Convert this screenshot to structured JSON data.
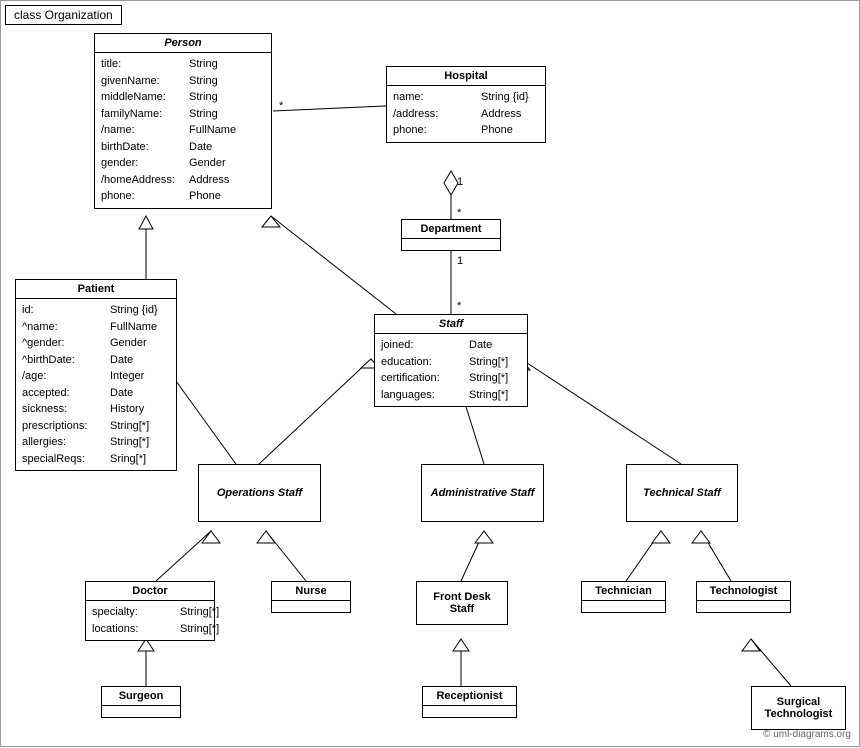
{
  "title": "class Organization",
  "copyright": "© uml-diagrams.org",
  "classes": {
    "person": {
      "name": "Person",
      "italic": true,
      "attrs": [
        {
          "name": "title:",
          "type": "String"
        },
        {
          "name": "givenName:",
          "type": "String"
        },
        {
          "name": "middleName:",
          "type": "String"
        },
        {
          "name": "familyName:",
          "type": "String"
        },
        {
          "name": "/name:",
          "type": "FullName"
        },
        {
          "name": "birthDate:",
          "type": "Date"
        },
        {
          "name": "gender:",
          "type": "Gender"
        },
        {
          "name": "/homeAddress:",
          "type": "Address"
        },
        {
          "name": "phone:",
          "type": "Phone"
        }
      ]
    },
    "hospital": {
      "name": "Hospital",
      "italic": false,
      "attrs": [
        {
          "name": "name:",
          "type": "String {id}"
        },
        {
          "name": "/address:",
          "type": "Address"
        },
        {
          "name": "phone:",
          "type": "Phone"
        }
      ]
    },
    "patient": {
      "name": "Patient",
      "italic": false,
      "attrs": [
        {
          "name": "id:",
          "type": "String {id}"
        },
        {
          "name": "^name:",
          "type": "FullName"
        },
        {
          "name": "^gender:",
          "type": "Gender"
        },
        {
          "name": "^birthDate:",
          "type": "Date"
        },
        {
          "name": "/age:",
          "type": "Integer"
        },
        {
          "name": "accepted:",
          "type": "Date"
        },
        {
          "name": "sickness:",
          "type": "History"
        },
        {
          "name": "prescriptions:",
          "type": "String[*]"
        },
        {
          "name": "allergies:",
          "type": "String[*]"
        },
        {
          "name": "specialReqs:",
          "type": "Sring[*]"
        }
      ]
    },
    "department": {
      "name": "Department",
      "italic": false,
      "attrs": []
    },
    "staff": {
      "name": "Staff",
      "italic": true,
      "attrs": [
        {
          "name": "joined:",
          "type": "Date"
        },
        {
          "name": "education:",
          "type": "String[*]"
        },
        {
          "name": "certification:",
          "type": "String[*]"
        },
        {
          "name": "languages:",
          "type": "String[*]"
        }
      ]
    },
    "operations_staff": {
      "name": "Operations Staff",
      "italic": true,
      "attrs": []
    },
    "administrative_staff": {
      "name": "Administrative Staff",
      "italic": true,
      "attrs": []
    },
    "technical_staff": {
      "name": "Technical Staff",
      "italic": true,
      "attrs": []
    },
    "doctor": {
      "name": "Doctor",
      "italic": false,
      "attrs": [
        {
          "name": "specialty:",
          "type": "String[*]"
        },
        {
          "name": "locations:",
          "type": "String[*]"
        }
      ]
    },
    "nurse": {
      "name": "Nurse",
      "italic": false,
      "attrs": []
    },
    "front_desk_staff": {
      "name": "Front Desk Staff",
      "italic": false,
      "attrs": []
    },
    "technician": {
      "name": "Technician",
      "italic": false,
      "attrs": []
    },
    "technologist": {
      "name": "Technologist",
      "italic": false,
      "attrs": []
    },
    "surgeon": {
      "name": "Surgeon",
      "italic": false,
      "attrs": []
    },
    "receptionist": {
      "name": "Receptionist",
      "italic": false,
      "attrs": []
    },
    "surgical_technologist": {
      "name": "Surgical Technologist",
      "italic": false,
      "attrs": []
    }
  },
  "multiplicity": {
    "star": "*",
    "one": "1"
  }
}
